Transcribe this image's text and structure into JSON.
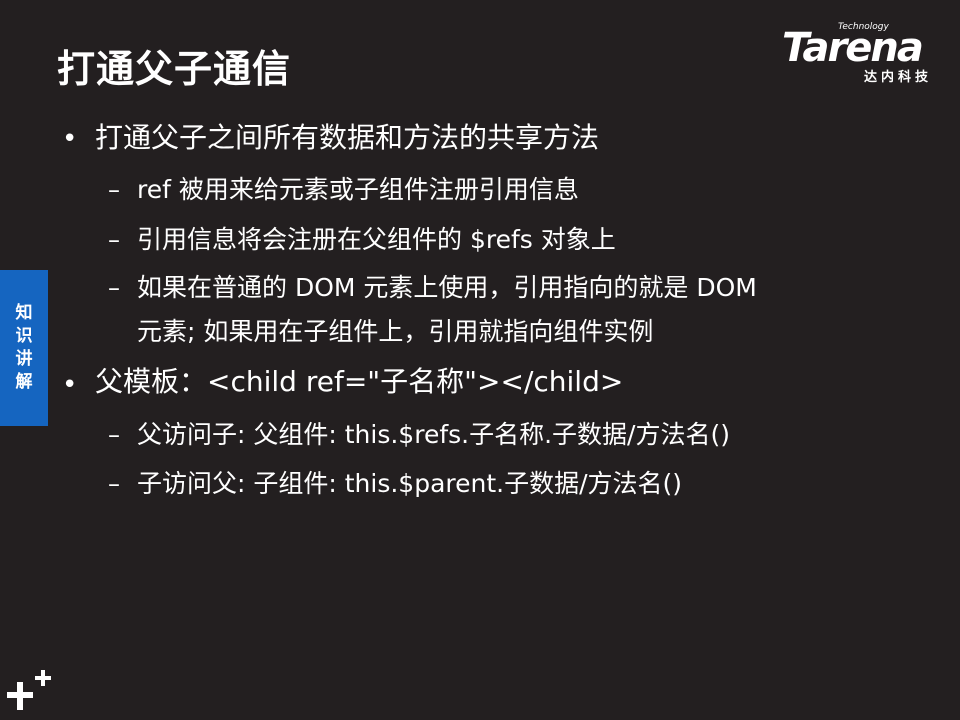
{
  "title": "打通父子通信",
  "logo": {
    "technology": "Technology",
    "word": "Tarena",
    "cn": "达内科技"
  },
  "side_tab": "知识讲解",
  "bullets": [
    {
      "text": "打通父子之间所有数据和方法的共享方法",
      "subs": [
        "ref 被用来给元素或子组件注册引用信息",
        "引用信息将会注册在父组件的 $refs 对象上",
        "如果在普通的 DOM 元素上使用，引用指向的就是 DOM",
        "元素; 如果用在子组件上，引用就指向组件实例"
      ]
    },
    {
      "text": "父模板：<child ref=\"子名称\"></child>",
      "subs": [
        "父访问子: 父组件: this.$refs.子名称.子数据/方法名()",
        "子访问父: 子组件: this.$parent.子数据/方法名()"
      ]
    }
  ],
  "bullet_symbol": "•",
  "dash_symbol": "–"
}
